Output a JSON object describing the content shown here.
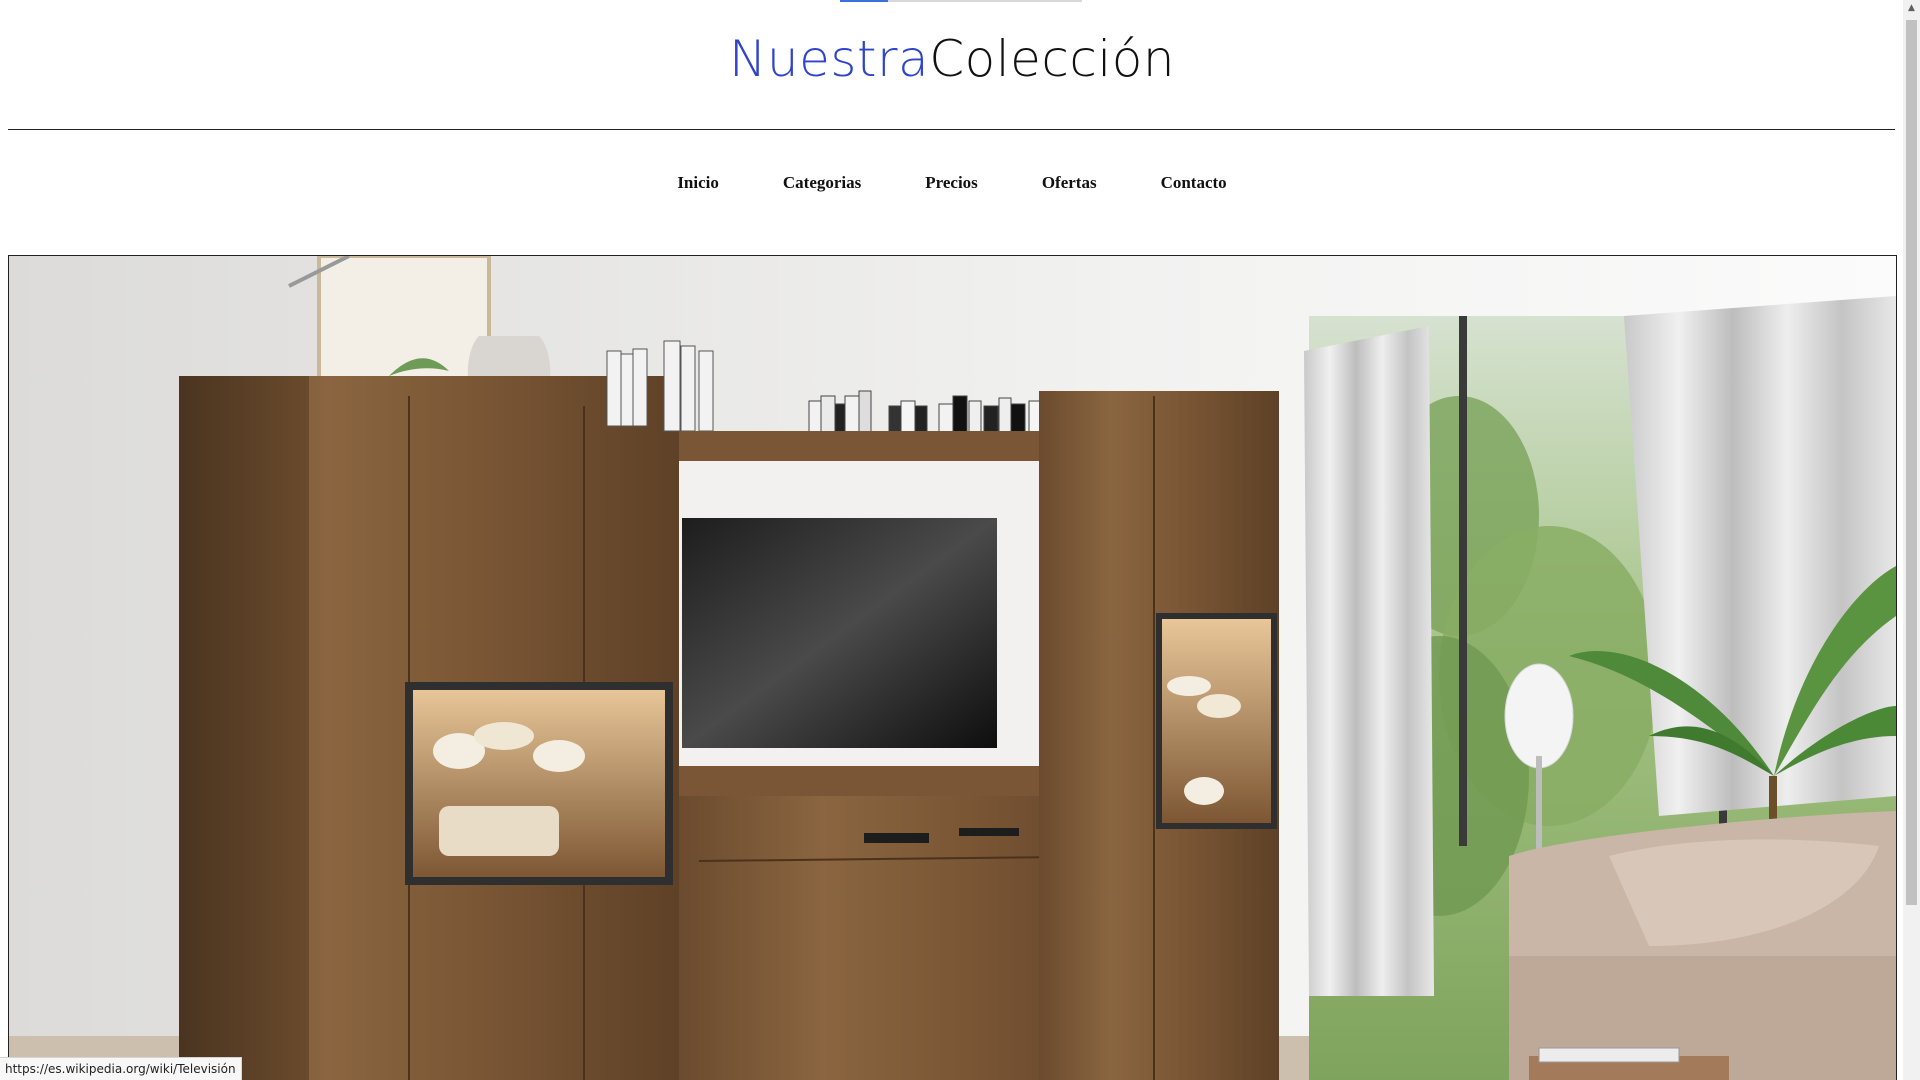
{
  "header": {
    "title_accent": "Nuestra",
    "title_rest": "Colección"
  },
  "nav": {
    "items": [
      {
        "label": "Inicio"
      },
      {
        "label": "Categorias"
      },
      {
        "label": "Precios"
      },
      {
        "label": "Ofertas"
      },
      {
        "label": "Contacto"
      }
    ]
  },
  "hero": {
    "image_description_icon": "living-room-furniture-image"
  },
  "status_bar": {
    "hover_url": "https://es.wikipedia.org/wiki/Televisión"
  },
  "colors": {
    "title_accent": "#2f44c9",
    "text": "#111111",
    "divider": "#222222"
  }
}
